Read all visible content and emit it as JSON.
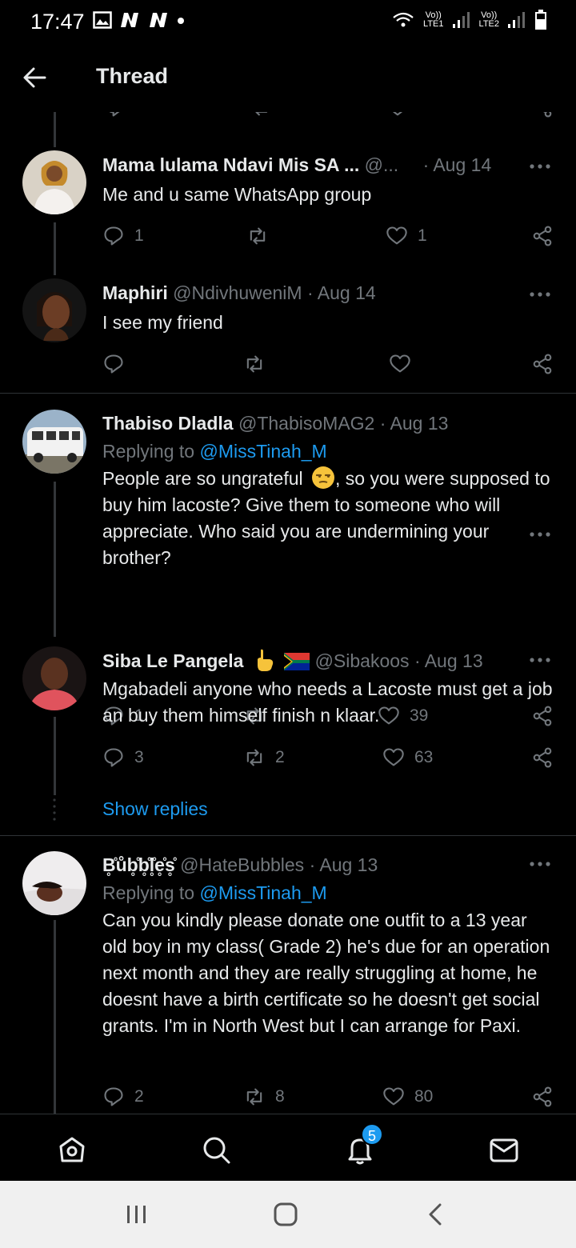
{
  "statusbar": {
    "time": "17:47",
    "sim1": "LTE1",
    "sim2": "LTE2",
    "volte": "Vo))"
  },
  "header": {
    "title": "Thread"
  },
  "tweets": [
    {
      "name": "Mama lulama Ndavi Mis SA ...",
      "handle": "@...",
      "date": "· Aug 14",
      "text": "Me and u same WhatsApp group",
      "replies": "1",
      "retweets": "",
      "likes": "1",
      "avatar_icon": "woman-white-top-avatar"
    },
    {
      "name": "Maphiri",
      "handle": "@NdivhuweniM",
      "date": "· Aug 14",
      "text": "I see my friend",
      "replies": "",
      "retweets": "",
      "likes": "",
      "avatar_icon": "woman-dark-avatar"
    },
    {
      "name": "Thabiso Dladla",
      "handle": "@ThabisoMAG2",
      "date": "· Aug 13",
      "replying_label": "Replying to",
      "replying_handle": "@MissTinah_M",
      "text_a": "People are so ungrateful",
      "text_b": ",  so you were supposed to buy him lacoste? Give them to someone who will appreciate. Who said you are undermining your brother?",
      "replies": "1",
      "retweets": "",
      "likes": "39",
      "avatar_icon": "white-minibus-avatar"
    },
    {
      "name": "Siba Le Pangela",
      "handle": "@Sibakoos",
      "date": "· Aug 13",
      "text": "Mgabadeli anyone who needs a Lacoste must get a job an buy them himself finish n klaar.",
      "replies": "3",
      "retweets": "2",
      "likes": "63",
      "avatar_icon": "man-red-shirt-avatar"
    },
    {
      "name": "B̥̊ůb̥̊b̥̊l̥̊e̥̊s̥̊",
      "handle": "@HateBubbles",
      "date": "· Aug 13",
      "replying_label": "Replying to",
      "replying_handle": "@MissTinah_M",
      "text": "Can you kindly please donate one outfit to a 13 year old boy in my class( Grade 2) he's due for an operation next month and they are really struggling at home, he doesnt have a birth certificate so he doesn't get social grants.  I'm in North West but I can arrange for Paxi.",
      "replies": "2",
      "retweets": "8",
      "likes": "80",
      "avatar_icon": "person-lying-avatar"
    }
  ],
  "show_replies": "Show replies",
  "notifications_badge": "5",
  "colors": {
    "accent": "#1d9bf0",
    "muted": "#71767b",
    "background": "#000000"
  }
}
